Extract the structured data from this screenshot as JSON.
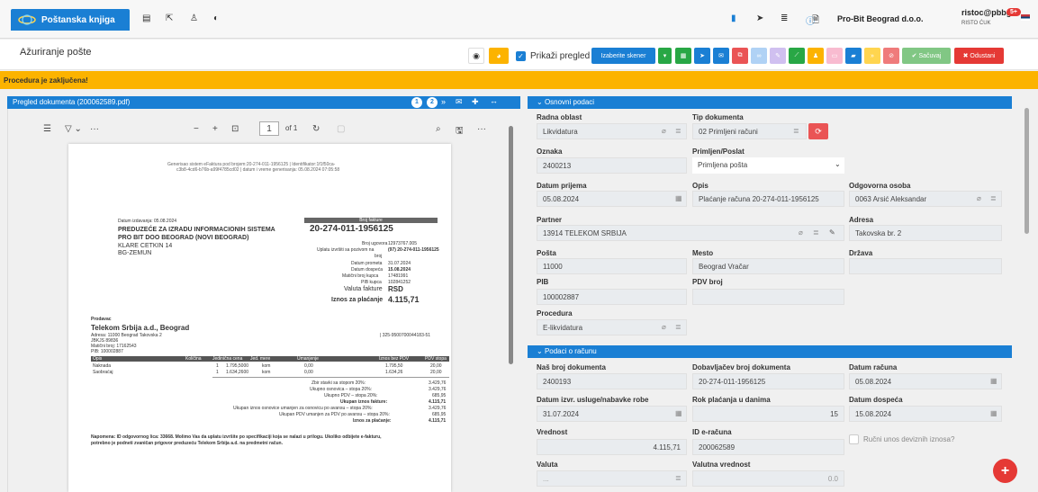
{
  "topbar": {
    "app_tab": "Poštanska knjiga",
    "company": "Pro-Bit Beograd d.o.o.",
    "user": "ristoc@pbbg",
    "user_name": "RISTO ĆUK",
    "badge": "5+"
  },
  "header": {
    "title": "Ažuriranje pošte",
    "show_preview": "Prikaži pregled",
    "scanner_btn": "Izaberite skener",
    "save": "✔ Sačuvaj",
    "cancel": "✖ Odustani"
  },
  "alert": "Procedura je zaključena!",
  "doc_panel": {
    "title": "Pregled dokumenta (200062589.pdf)",
    "page_num": "1",
    "page_of": "of 1",
    "p1": "1",
    "p2": "2"
  },
  "pdf": {
    "gen1": "Generisao sistem eFaktura pod brojem:20-274-011-1956125 | Identifikator:1f1f50ca-",
    "gen2": "c3b8-4cd6-b76b-a99f4785cd02 | datum i vreme generisanja: 05.08.2024 07:05:58",
    "datum_izd": "Datum izdavanja: 05.08.2024",
    "kupac1": "PREDUZEĆE ZA IZRADU INFORMACIONIH SISTEMA",
    "kupac2": "PRO BIT DOO BEOGRAD (NOVI BEOGRAD)",
    "kupac3": "KLARE CETKIN 14",
    "kupac4": "BG-ZEMUN",
    "broj_fakture_lbl": "Broj fakture",
    "broj_fakture": "20-274-011-1956125",
    "bu_lbl": "Broj ugovora",
    "bu": "12973767.005",
    "up_lbl": "Uplatu izvršiti sa pozivom na",
    "up": "(97) 20-274-011-1956125",
    "broj_lbl": "broj",
    "dp_lbl": "Datum prometa",
    "dp": "31.07.2024",
    "dd_lbl": "Datum dospeća",
    "dd": "15.08.2024",
    "mb_lbl": "Matični broj kupca",
    "mb": "17481991",
    "pib_lbl": "PIB kupca",
    "pib": "102841252",
    "val_lbl": "Valuta fakture",
    "val": "RSD",
    "iznos_lbl": "Iznos za plaćanje",
    "iznos": "4.115,71",
    "prodavac": "Prodavac",
    "pr_name": "Telekom Srbija a.d., Beograd",
    "pr_adr": "Adresa: 11000 Beograd Takovska 2",
    "pr_jbkjs": "JBKJS 89836",
    "pr_mb": "Matični broj: 17162543",
    "pr_pib": "PIB: 100002887",
    "pr_racun": "| 325-9500700044183-51",
    "th": [
      "Opis",
      "Količina",
      "Jedinična cena",
      "Jed. mere",
      "Umanjenje",
      "Iznos bez PDV",
      "PDV stopa"
    ],
    "r1": [
      "Naknada",
      "1",
      "1.795,5000",
      "kom",
      "0,00",
      "1.795,50",
      "20,00"
    ],
    "r2": [
      "Saobraćaj",
      "1",
      "1.634,2600",
      "kom",
      "0,00",
      "1.634,26",
      "20,00"
    ],
    "s1": [
      "Zbir stavki sa stopom 20%:",
      "3.429,76"
    ],
    "s2": [
      "Ukupno osnovica – stopa 20%:",
      "3.429,76"
    ],
    "s3": [
      "Ukupno PDV – stopa 20%:",
      "685,95"
    ],
    "s4": [
      "Ukupan iznos fakture:",
      "4.115,71"
    ],
    "s5": [
      "Ukupan iznos osnovice umanjen za osnovicu po avansu – stopa 20%:",
      "3.429,76"
    ],
    "s6": [
      "Ukupan PDV umanjen za PDV po avansu – stopa 20%:",
      "685,95"
    ],
    "s7": [
      "Iznos za plaćanje:",
      "4.115,71"
    ],
    "nap1": "Napomena: ID odgovornog lica: 33668. Molimo Vas da uplatu izvršite po specifikaciji koja se nalazi u prilogu. Ukoliko odbijete e-fakturu,",
    "nap2": "potrebno je podneti zvaničan prigovor preduzeću Telekom Srbija a.d. na predmetni račun."
  },
  "osnovni": {
    "title": "Osnovni podaci",
    "radna_lbl": "Radna oblast",
    "radna": "Likvidatura",
    "tip_lbl": "Tip dokumenta",
    "tip": "02 Primljeni računi",
    "oznaka_lbl": "Oznaka",
    "oznaka": "2400213",
    "prim_lbl": "Primljen/Poslat",
    "prim": "Primljena pošta",
    "dp_lbl": "Datum prijema",
    "dp": "05.08.2024",
    "opis_lbl": "Opis",
    "opis": "Plaćanje računa 20-274-011-1956125",
    "odg_lbl": "Odgovorna osoba",
    "odg": "0063 Arsić Aleksandar",
    "partner_lbl": "Partner",
    "partner": "13914 TELEKOM SRBIJA",
    "adresa_lbl": "Adresa",
    "adresa": "Takovska br. 2",
    "posta_lbl": "Pošta",
    "posta": "11000",
    "mesto_lbl": "Mesto",
    "mesto": "Beograd Vračar",
    "drzava_lbl": "Država",
    "drzava": "",
    "pib_lbl": "PIB",
    "pib": "100002887",
    "pdv_lbl": "PDV broj",
    "pdv": "",
    "proc_lbl": "Procedura",
    "proc": "E-likvidatura"
  },
  "racun": {
    "title": "Podaci o računu",
    "nb_lbl": "Naš broj dokumenta",
    "nb": "2400193",
    "db_lbl": "Dobavljačev broj dokumenta",
    "db": "20-274-011-1956125",
    "dr_lbl": "Datum računa",
    "dr": "05.08.2024",
    "du_lbl": "Datum izvr. usluge/nabavke robe",
    "du": "31.07.2024",
    "rok_lbl": "Rok plaćanja u danima",
    "rok": "15",
    "dd_lbl": "Datum dospeća",
    "dd": "15.08.2024",
    "vr_lbl": "Vrednost",
    "vr": "4.115,71",
    "ide_lbl": "ID e-računa",
    "ide": "200062589",
    "rucni": "Ručni unos deviznih iznosa?",
    "val_lbl": "Valuta",
    "val": "...",
    "vv_lbl": "Valutna vrednost",
    "vv": "0.0"
  }
}
